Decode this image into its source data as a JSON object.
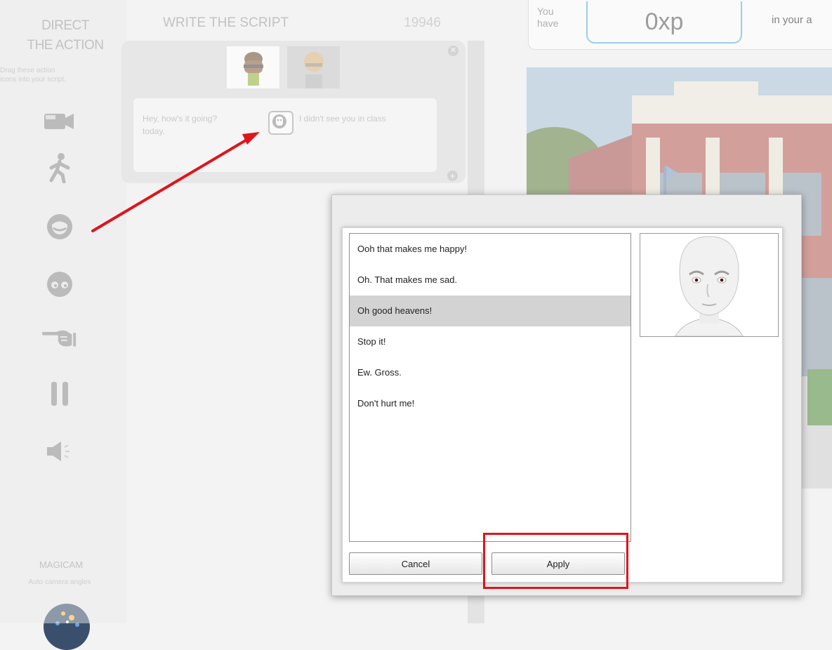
{
  "left_panel": {
    "title_line1": "DIRECT",
    "title_line2": "THE ACTION",
    "hint_line1": "Drag these action",
    "hint_line2": "icons into your script.",
    "icons": [
      "camera-icon",
      "walk-icon",
      "emotion-icon",
      "look-icon",
      "point-icon",
      "pause-icon",
      "sound-icon"
    ],
    "magicam_title": "MAGICAM",
    "magicam_hint": "Auto camera angles"
  },
  "script": {
    "header": "WRITE THE SCRIPT",
    "count": "19946",
    "line_part1": "Hey, how's it going?",
    "line_part2": "I didn't see you in class",
    "line_part3": "today."
  },
  "xp": {
    "you": "You",
    "have": "have",
    "value": "0xp",
    "suffix": "in your a"
  },
  "dialog": {
    "options": [
      "Ooh that makes me happy!",
      "Oh. That makes me sad.",
      "Oh good heavens!",
      "Stop it!",
      "Ew. Gross.",
      "Don't hurt me!"
    ],
    "selected_index": 2,
    "cancel_label": "Cancel",
    "apply_label": "Apply"
  },
  "colors": {
    "annotation": "#e0141b",
    "xp_border": "#4bb3e2",
    "selected_row": "#d3d3d3"
  }
}
